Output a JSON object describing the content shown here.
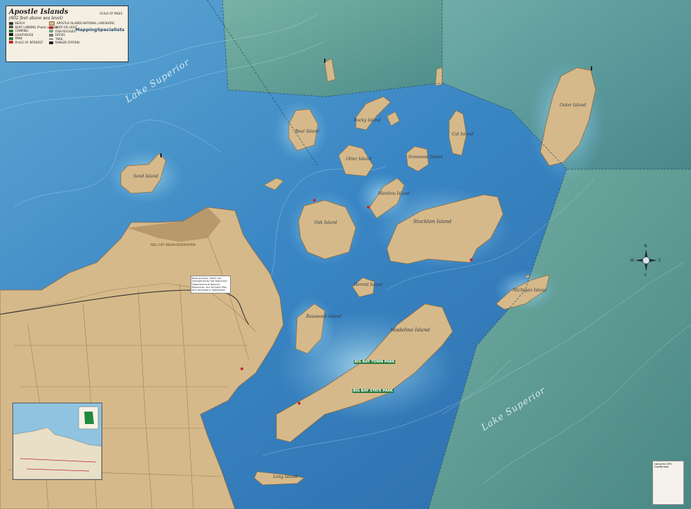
{
  "legend": {
    "title": "Apostle Islands",
    "subtitle": "(602 feet above sea level)",
    "scale_label": "SCALE OF MILES",
    "brand": "MappingSpecialists",
    "items": [
      "BEACH",
      "BOAT LANDING (Public access)",
      "CAMPING",
      "LIGHTHOUSE",
      "PARK",
      "PLACE OF INTEREST",
      "APOSTLE ISLANDS NATIONAL LAKESHORE",
      "BUOY OR LIGHT",
      "FISH REFUGES",
      "ROCKS",
      "TRAIL",
      "RANGER STATION"
    ]
  },
  "lake_labels": [
    "Lake Superior",
    "Lake Superior"
  ],
  "islands": {
    "sand": "Sand Island",
    "bear": "Bear Island",
    "rocky": "Rocky Island",
    "otter": "Otter Island",
    "ironwood": "Ironwood Island",
    "cat": "Cat Island",
    "outer": "Outer Island",
    "manitou": "Manitou Island",
    "oak": "Oak Island",
    "stockton": "Stockton Island",
    "hermit": "Hermit Island",
    "basswood": "Basswood Island",
    "madeline": "Madeline Island",
    "michigan": "Michigan Island",
    "long": "Long Island"
  },
  "places": {
    "big_bay_town_park": "BIG BAY TOWN PARK",
    "big_bay_state_park": "BIG BAY STATE PARK",
    "red_cliff": "RED CLIFF INDIAN RESERVATION"
  },
  "note_text": "Boat anchors, which are maintained by the Wisconsin Department of Natural Resources, are set each May and removed in September.",
  "gps_title": "Using the GPS Coordinates",
  "compass": {
    "n": "N",
    "s": "S",
    "e": "E",
    "w": "W"
  },
  "colors": {
    "deep": "#2f6fae",
    "shallow": "#7fc4e3",
    "land": "#d6b98a",
    "green": "#5e9a86"
  }
}
